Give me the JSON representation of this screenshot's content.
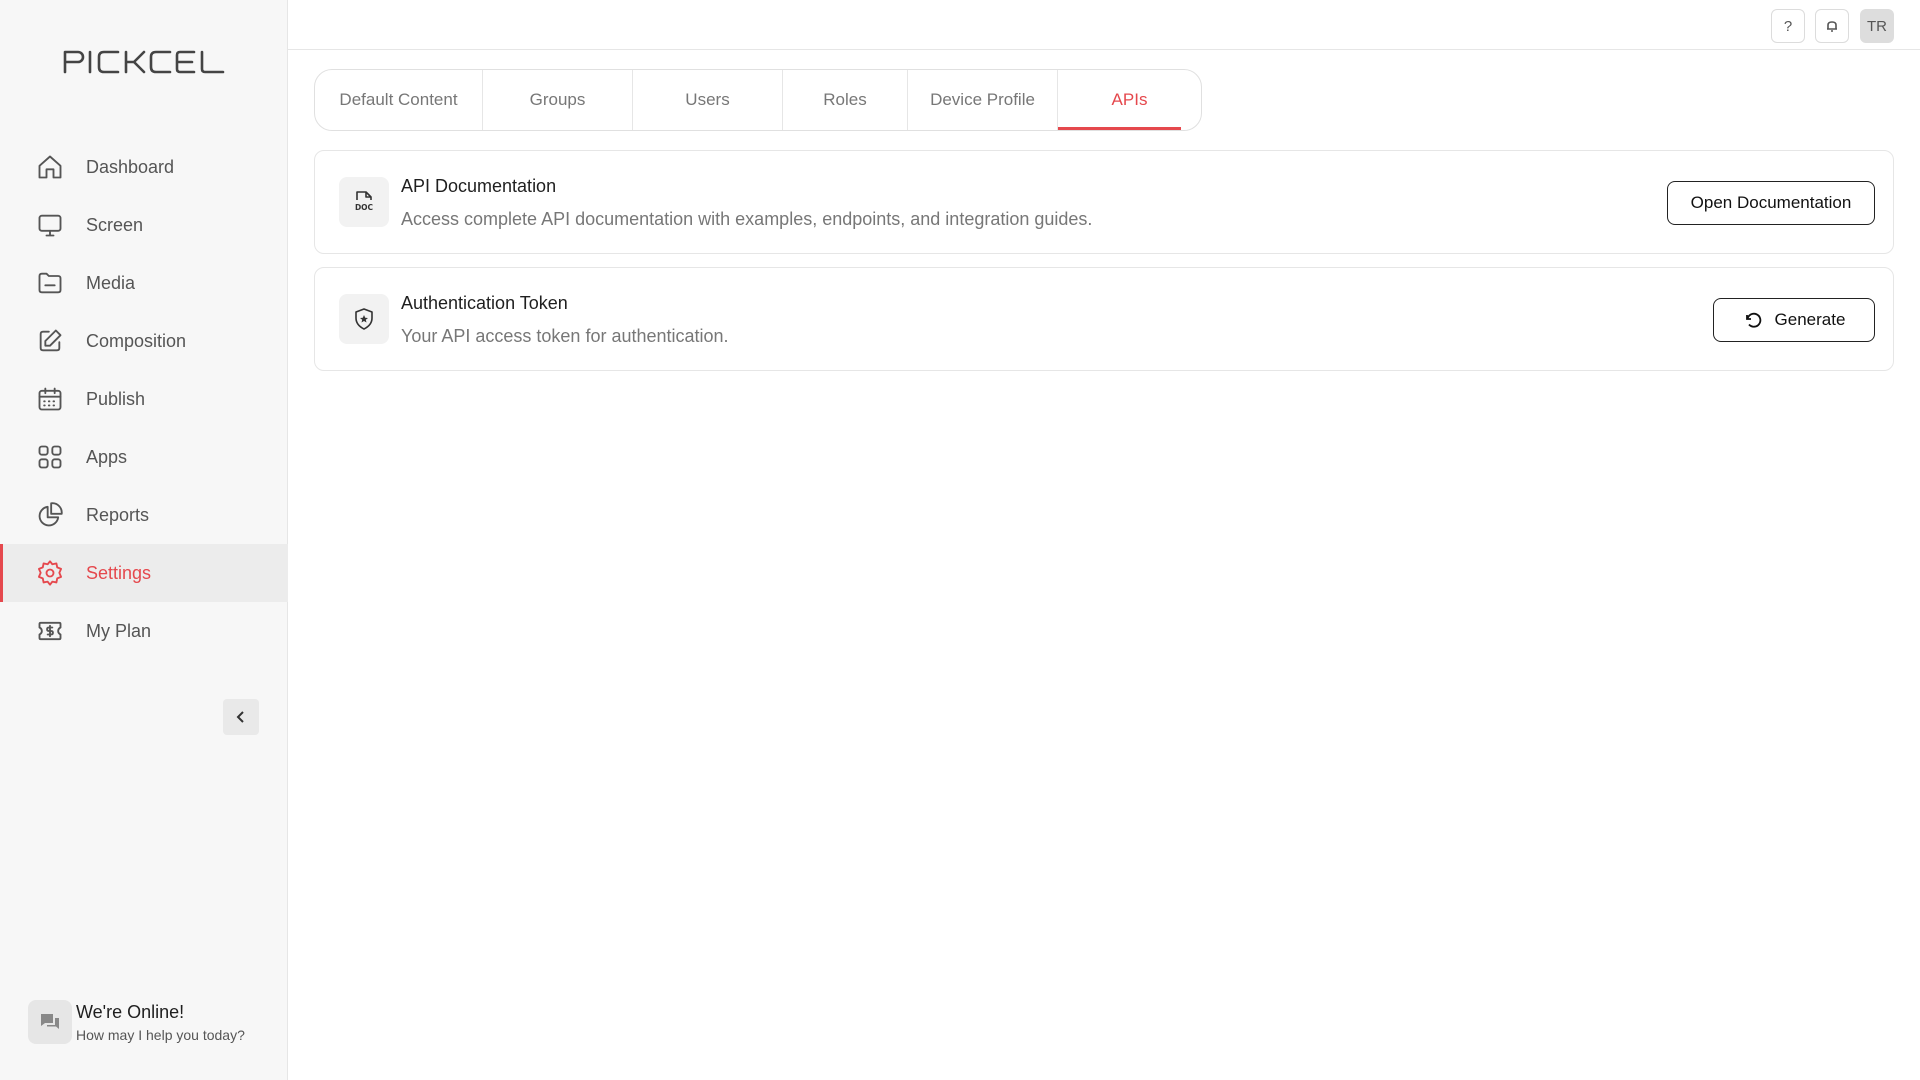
{
  "app": {
    "logo_text": "PICKCEL"
  },
  "sidebar": {
    "items": [
      {
        "label": "Dashboard",
        "icon": "home-icon"
      },
      {
        "label": "Screen",
        "icon": "monitor-icon"
      },
      {
        "label": "Media",
        "icon": "folder-icon"
      },
      {
        "label": "Composition",
        "icon": "edit-icon"
      },
      {
        "label": "Publish",
        "icon": "calendar-icon"
      },
      {
        "label": "Apps",
        "icon": "grid-icon"
      },
      {
        "label": "Reports",
        "icon": "pie-chart-icon"
      },
      {
        "label": "Settings",
        "icon": "gear-icon",
        "active": true
      },
      {
        "label": "My Plan",
        "icon": "dollar-ticket-icon"
      }
    ],
    "chat": {
      "title": "We're Online!",
      "subtitle": "How may I help you today?"
    }
  },
  "topbar": {
    "help_label": "?",
    "avatar_initials": "TR"
  },
  "tabs": [
    {
      "label": "Default Content"
    },
    {
      "label": "Groups"
    },
    {
      "label": "Users"
    },
    {
      "label": "Roles"
    },
    {
      "label": "Device Profile"
    },
    {
      "label": "APIs",
      "active": true
    }
  ],
  "cards": {
    "api_docs": {
      "title": "API Documentation",
      "description": "Access complete API documentation with examples, endpoints, and integration guides.",
      "button_label": "Open Documentation"
    },
    "auth_token": {
      "title": "Authentication Token",
      "description": "Your API access token for authentication.",
      "button_label": "Generate"
    }
  },
  "colors": {
    "accent": "#e5484d",
    "sidebar_bg": "#f7f7f7"
  }
}
